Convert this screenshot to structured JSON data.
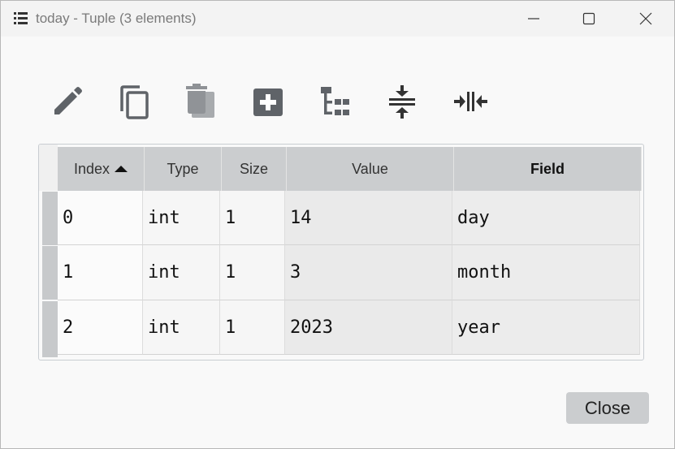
{
  "window": {
    "title": "today - Tuple (3 elements)",
    "controls": [
      "minimize-icon",
      "maximize-icon",
      "close-icon"
    ]
  },
  "toolbar": {
    "tools": [
      "edit-icon",
      "copy-icon",
      "delete-icon",
      "insert-icon",
      "tree-icon",
      "collapse-vertical-icon",
      "collapse-horizontal-icon"
    ]
  },
  "table": {
    "columns": [
      "Index",
      "Type",
      "Size",
      "Value",
      "Field"
    ],
    "sorted_column": "Index",
    "sort_direction": "ascending",
    "rows": [
      [
        "0",
        "int",
        "1",
        "14",
        "day"
      ],
      [
        "1",
        "int",
        "1",
        "3",
        "month"
      ],
      [
        "2",
        "int",
        "1",
        "2023",
        "year"
      ]
    ]
  },
  "footer": {
    "close_label": "Close"
  },
  "colors": {
    "header_bg": "#cbcdcf",
    "button_bg": "#cbcdcf",
    "icon": "#5f6368"
  }
}
